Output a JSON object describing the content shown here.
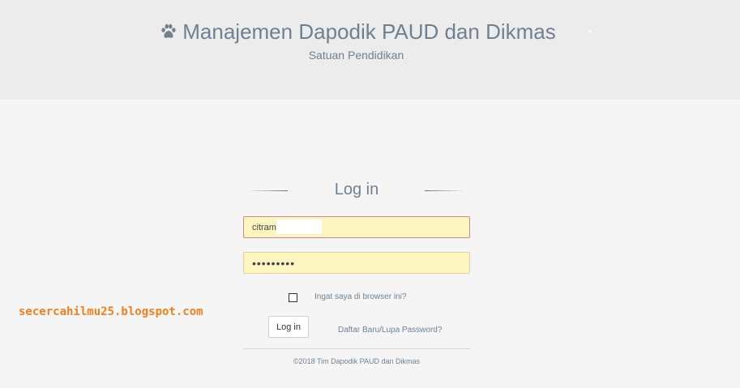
{
  "header": {
    "icon": "paw-icon",
    "title": "Manajemen Dapodik PAUD dan Dikmas",
    "subtitle": "Satuan Pendidikan"
  },
  "login": {
    "heading": "Log in",
    "email_value": "citram          .com",
    "password_value": "•••••••••",
    "remember_label": "Ingat saya di browser ini?",
    "login_button": "Log in",
    "register_link": "Daftar Baru/Lupa Password?"
  },
  "footer": {
    "copyright": "©2018 Tim Dapodik PAUD dan Dikmas"
  },
  "watermark": {
    "text": "secercahilmu25.blogspot.com"
  },
  "colors": {
    "header_bg": "#ececec",
    "page_bg": "#f5f5f5",
    "text_accent": "#6f8191",
    "autofill_bg": "#fdf6c2",
    "watermark": "#f07f1f"
  }
}
